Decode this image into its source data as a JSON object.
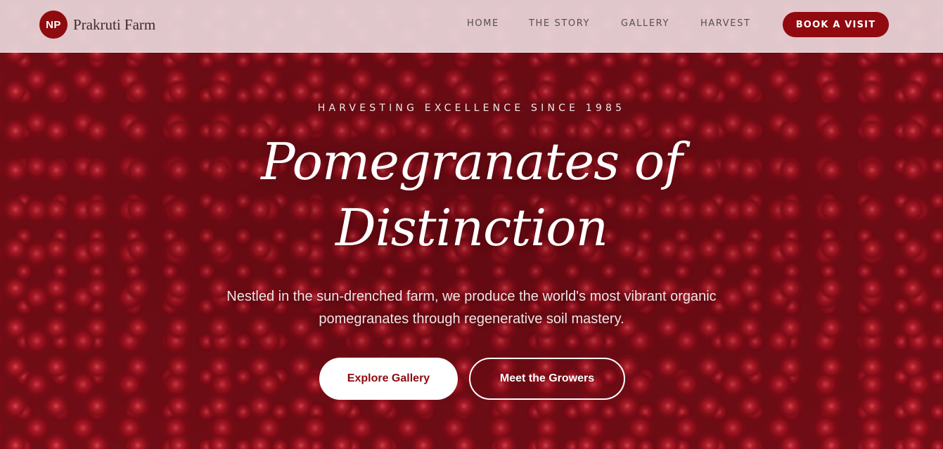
{
  "brand": {
    "logo_text": "NP",
    "name": "Prakruti Farm"
  },
  "nav": {
    "links": [
      "HOME",
      "THE STORY",
      "GALLERY",
      "HARVEST"
    ],
    "cta_label": "BOOK A VISIT"
  },
  "hero": {
    "eyebrow": "HARVESTING EXCELLENCE SINCE 1985",
    "headline_line1": "Pomegranates of",
    "headline_line2": "Distinction",
    "subtitle": "Nestled in the sun-drenched farm, we produce the world's most vibrant organic pomegranates through regenerative soil mastery.",
    "primary_button": "Explore Gallery",
    "secondary_button": "Meet the Growers"
  },
  "colors": {
    "brand_red": "#910a10",
    "navbar_bg": "#e8d6d9",
    "white": "#ffffff"
  }
}
